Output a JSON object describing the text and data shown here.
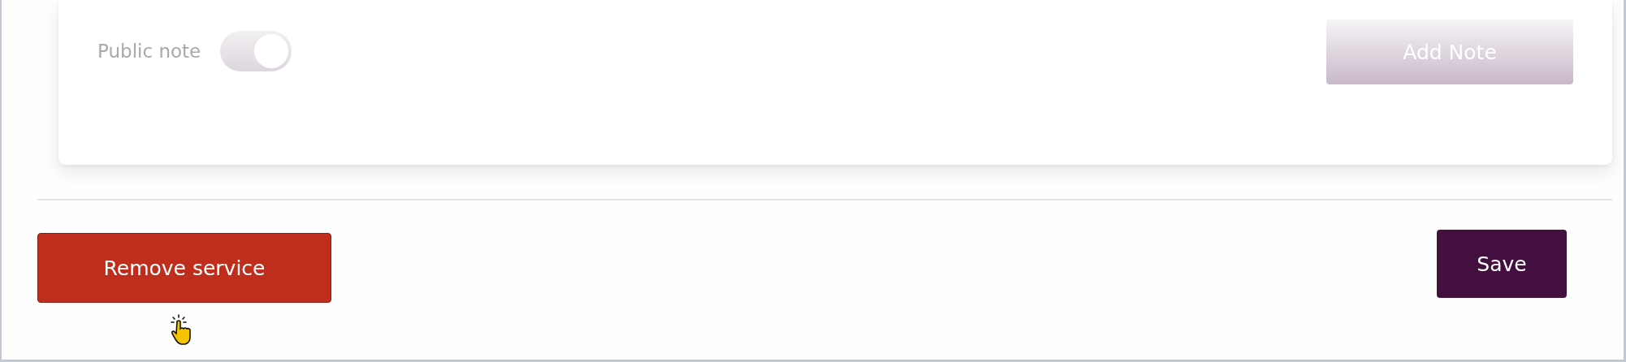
{
  "note_form": {
    "disabled": true,
    "public_note": {
      "label": "Public note",
      "on": true
    },
    "add_button": {
      "label": "Add Note"
    }
  },
  "footer": {
    "remove_button": {
      "label": "Remove service"
    },
    "save_button": {
      "label": "Save"
    }
  }
}
